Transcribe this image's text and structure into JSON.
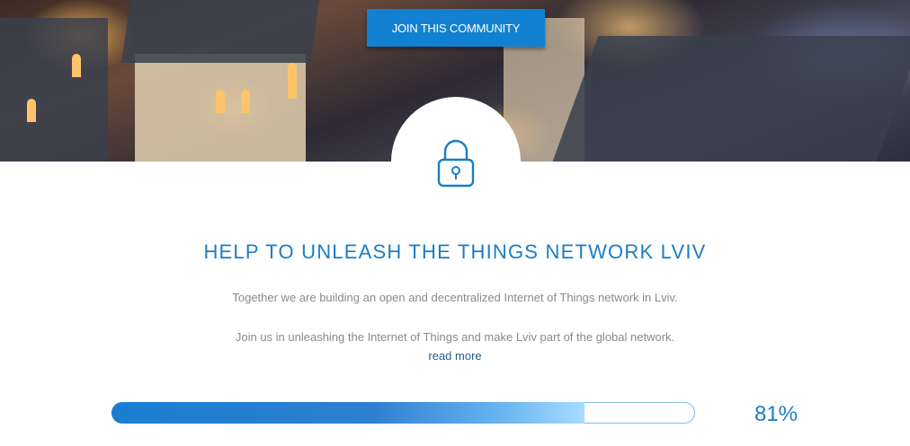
{
  "hero": {
    "join_button_label": "JOIN THIS COMMUNITY"
  },
  "icons": {
    "lock": "lock-icon"
  },
  "content": {
    "headline": "HELP TO UNLEASH THE THINGS NETWORK LVIV",
    "description_1": "Together we are building an open and decentralized Internet of Things network in Lviv.",
    "description_2": "Join us in unleashing the Internet of Things and make Lviv part of the global network.",
    "read_more": "read more"
  },
  "progress": {
    "value": 0.81,
    "label": "81%"
  },
  "colors": {
    "accent": "#1a7dc5",
    "button": "#1281d1",
    "text_muted": "#8a8a8a"
  }
}
